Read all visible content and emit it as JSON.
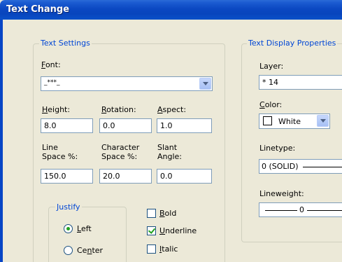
{
  "window": {
    "title": "Text Change"
  },
  "text_settings": {
    "title": "Text Settings",
    "font": {
      "label_ul": "F",
      "label_rest": "ont:",
      "value": "_***_"
    },
    "height": {
      "label_ul": "H",
      "label_rest": "eight:",
      "value": "8.0"
    },
    "rotation": {
      "label_ul": "R",
      "label_rest": "otation:",
      "value": "0.0"
    },
    "aspect": {
      "label_ul": "A",
      "label_rest": "spect:",
      "value": "1.0"
    },
    "line_space": {
      "label_line1": "Line",
      "label_line2": "Space %:",
      "value": "150.0"
    },
    "char_space": {
      "label_line1": "Character",
      "label_line2": "Space %:",
      "value": "20.0"
    },
    "slant": {
      "label_line1": "Slant",
      "label_line2": "Angle:",
      "value": "0.0"
    },
    "justify": {
      "title": "Justify",
      "left": {
        "label_ul": "L",
        "label_rest": "eft",
        "checked": true
      },
      "center": {
        "label_pre": "Ce",
        "label_ul": "n",
        "label_rest": "ter",
        "checked": false
      }
    },
    "bold": {
      "label_ul": "B",
      "label_rest": "old",
      "checked": false
    },
    "underline": {
      "label_ul": "U",
      "label_rest": "nderline",
      "checked": true
    },
    "italic": {
      "label_ul": "I",
      "label_rest": "talic",
      "checked": false
    }
  },
  "display_props": {
    "title": "Text Display Properties",
    "layer": {
      "label": "Layer:",
      "value": "* 14"
    },
    "color": {
      "label_ul": "C",
      "label_rest": "olor:",
      "value": "White",
      "swatch": "#ffffff"
    },
    "linetype": {
      "label": "Linetype:",
      "value": "0 (SOLID)"
    },
    "lineweight": {
      "label": "Lineweight:",
      "value": "0"
    }
  },
  "colors": {
    "title_bar": "#0a50c8",
    "frame_title": "#0046d5",
    "dialog_bg": "#ece9d8",
    "check_green": "#21a121"
  }
}
